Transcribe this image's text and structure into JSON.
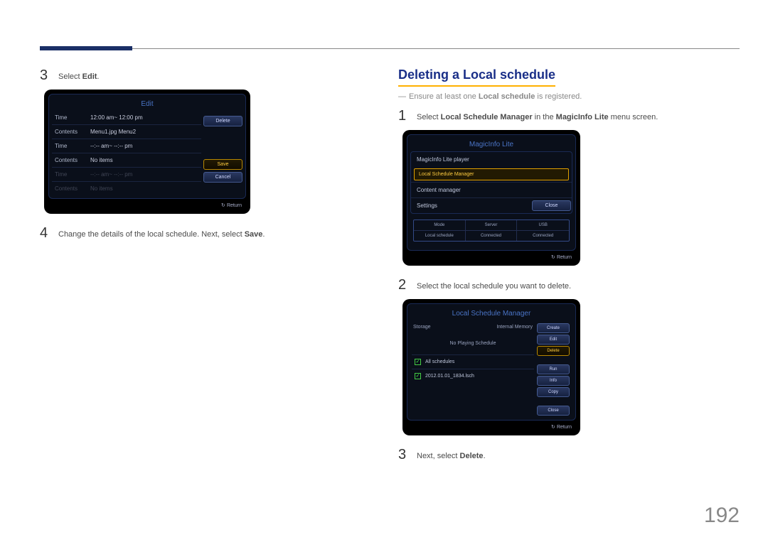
{
  "page_number": "192",
  "left": {
    "step3": {
      "prefix": "Select ",
      "bold": "Edit",
      "suffix": "."
    },
    "step4": {
      "prefix": "Change the details of the local schedule. Next, select ",
      "bold": "Save",
      "suffix": "."
    },
    "edit_panel": {
      "title": "Edit",
      "rows": {
        "time1_label": "Time",
        "time1_val": "12:00 am~ 12:00 pm",
        "contents1_label": "Contents",
        "contents1_val": "Menu1.jpg Menu2",
        "time2_label": "Time",
        "time2_val": "--:-- am~ --:-- pm",
        "contents2_label": "Contents",
        "contents2_val": "No items",
        "time3_label": "Time",
        "time3_val": "--:-- am~ --:-- pm",
        "contents3_label": "Contents",
        "contents3_val": "No items"
      },
      "buttons": {
        "delete": "Delete",
        "save": "Save",
        "cancel": "Cancel"
      },
      "return": "Return"
    }
  },
  "right": {
    "heading": "Deleting a Local schedule",
    "note": {
      "dash": "―",
      "p1": "Ensure at least one ",
      "bold": "Local schedule",
      "p2": " is registered."
    },
    "step1": {
      "p1": "Select ",
      "b1": "Local Schedule Manager",
      "p2": " in the ",
      "b2": "MagicInfo Lite",
      "p3": " menu screen."
    },
    "step2": "Select the local schedule you want to delete.",
    "step3": {
      "p1": "Next, select ",
      "b1": "Delete",
      "p2": "."
    },
    "magic_panel": {
      "title": "MagicInfo Lite",
      "items": {
        "i1": "MagicInfo Lite player",
        "i2": "Local Schedule Manager",
        "i3": "Content manager",
        "i4": "Settings"
      },
      "close": "Close",
      "status": {
        "h1": "Mode",
        "h2": "Server",
        "h3": "USB",
        "v1": "Local schedule",
        "v2": "Connected",
        "v3": "Connected"
      },
      "return": "Return"
    },
    "lsm_panel": {
      "title": "Local Schedule Manager",
      "storage_label": "Storage",
      "storage_val": "Internal Memory",
      "subtitle": "No Playing Schedule",
      "item1": "All schedules",
      "item2": "2012.01.01_1834.lsch",
      "buttons": {
        "create": "Create",
        "edit": "Edit",
        "delete": "Delete",
        "run": "Run",
        "info": "Info",
        "copy": "Copy",
        "close": "Close"
      },
      "return": "Return"
    }
  }
}
